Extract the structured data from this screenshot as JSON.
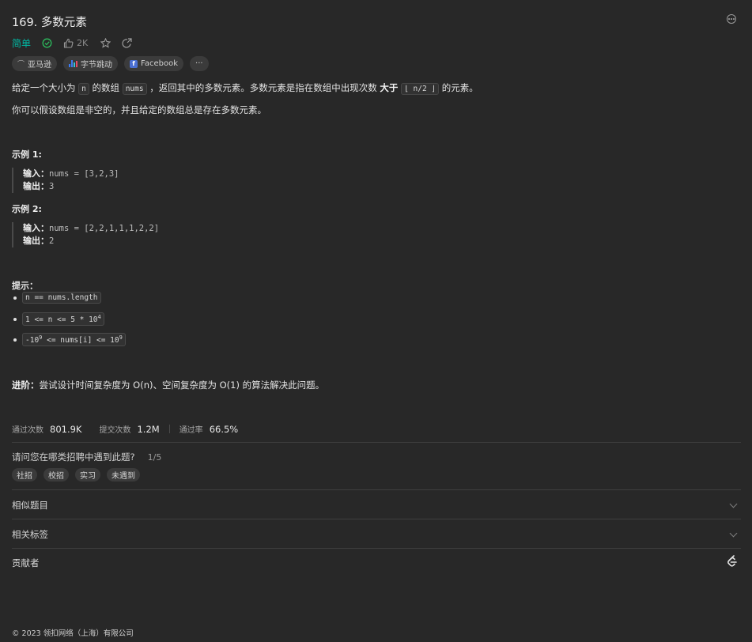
{
  "problem": {
    "title": "169. 多数元素",
    "difficulty": "简单",
    "likes": "2K",
    "companies": [
      "亚马逊",
      "字节跳动",
      "Facebook"
    ],
    "more_companies": "···"
  },
  "description": {
    "p1_a": "给定一个大小为",
    "p1_code_n": "n",
    "p1_b": "的数组",
    "p1_code_nums": "nums",
    "p1_c": "，返回其中的多数元素。多数元素是指在数组中出现次数",
    "p1_bold": "大于",
    "p1_code_floor": "⌊ n/2 ⌋",
    "p1_d": "的元素。",
    "p2": "你可以假设数组是非空的，并且给定的数组总是存在多数元素。"
  },
  "examples": [
    {
      "title": "示例 1:",
      "input_label": "输入：",
      "input": "nums = [3,2,3]",
      "output_label": "输出：",
      "output": "3"
    },
    {
      "title": "示例 2:",
      "input_label": "输入：",
      "input": "nums = [2,2,1,1,1,2,2]",
      "output_label": "输出：",
      "output": "2"
    }
  ],
  "hints": {
    "title": "提示：",
    "h1": "n == nums.length",
    "h2_a": "1 <= n <= 5 * 10",
    "h2_exp": "4",
    "h3_a": "-10",
    "h3_exp1": "9",
    "h3_b": " <= nums[i] <= 10",
    "h3_exp2": "9"
  },
  "advanced": {
    "label": "进阶：",
    "text": "尝试设计时间复杂度为 O(n)、空间复杂度为 O(1) 的算法解决此问题。"
  },
  "stats": {
    "accepted_label": "通过次数",
    "accepted": "801.9K",
    "submissions_label": "提交次数",
    "submissions": "1.2M",
    "rate_label": "通过率",
    "rate": "66.5%"
  },
  "survey": {
    "question": "请问您在哪类招聘中遇到此题?",
    "count": "1/5",
    "options": [
      "社招",
      "校招",
      "实习",
      "未遇到"
    ]
  },
  "sections": {
    "similar": "相似题目",
    "tags": "相关标签",
    "contributors": "贡献者"
  },
  "footer": "© 2023 领扣网络（上海）有限公司"
}
